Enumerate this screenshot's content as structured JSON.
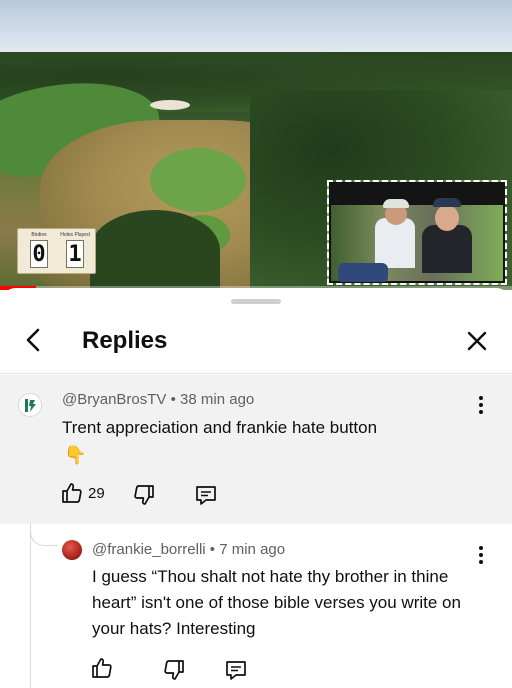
{
  "video": {
    "scoreboard": {
      "birdies_label": "Birdies",
      "holes_label": "Holes Played",
      "birdies_value": "0",
      "holes_value": "1"
    },
    "progress_fraction": 0.07,
    "progress_color": "#ff0000"
  },
  "panel": {
    "title": "Replies",
    "back_icon": "chevron-left-icon",
    "close_icon": "close-icon"
  },
  "parent_comment": {
    "author": "@BryanBrosTV",
    "time": "38 min ago",
    "text": "Trent appreciation and frankie hate button",
    "emoji": "👇",
    "likes": "29",
    "highlight_color": "#f2f2f2"
  },
  "reply": {
    "author": "@frankie_borrelli",
    "time": "7 min ago",
    "text": "I guess “Thou shalt not hate thy brother in thine heart” isn't one of those bible verses you write on your hats?  Interesting",
    "likes": ""
  },
  "separator": "•"
}
